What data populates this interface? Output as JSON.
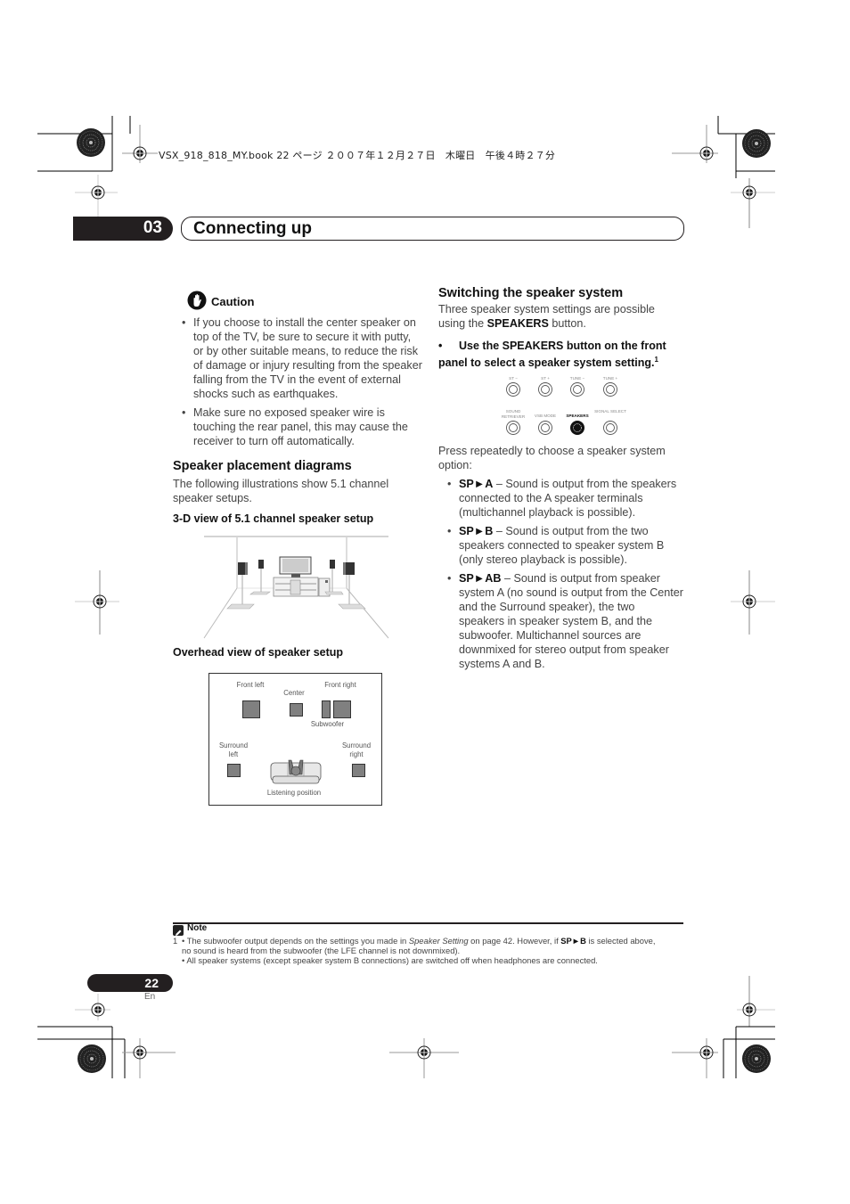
{
  "print_header": {
    "text": "VSX_918_818_MY.book  22 ページ  ２００７年１２月２７日　木曜日　午後４時２７分"
  },
  "chapter": {
    "number": "03",
    "title": "Connecting up"
  },
  "caution": {
    "title": "Caution",
    "icon": "hand-stop-icon",
    "items": [
      "If you choose to install the center speaker on top of the TV, be sure to secure it with putty, or by other suitable means, to reduce the risk of damage or injury resulting from the speaker falling from the TV in the event of external shocks such as earthquakes.",
      "Make sure no exposed speaker wire is touching the rear panel, this may cause the receiver to turn off automatically."
    ]
  },
  "placement": {
    "heading": "Speaker placement diagrams",
    "intro": "The following illustrations show 5.1 channel speaker setups.",
    "view3d_heading": "3-D view of 5.1 channel speaker setup",
    "overhead_heading": "Overhead view of speaker setup",
    "overhead_labels": {
      "front_left": "Front left",
      "center": "Center",
      "front_right": "Front right",
      "subwoofer": "Subwoofer",
      "surround_left": "Surround left",
      "surround_right": "Surround right",
      "listening_position": "Listening position"
    }
  },
  "switching": {
    "heading": "Switching the speaker system",
    "intro_pre": "Three speaker system settings are possible using the ",
    "intro_bold": "SPEAKERS",
    "intro_post": " button.",
    "step": "Use the SPEAKERS button on the front panel to select a speaker system setting.",
    "step_footnote": "1",
    "panel_buttons_row1": [
      "ST −",
      "ST +",
      "TUNE −",
      "TUNE +"
    ],
    "panel_buttons_row2": [
      "SOUND RETRIEVER",
      "VSB MODE",
      "SPEAKERS",
      "SIGNAL SELECT"
    ],
    "panel_active": "SPEAKERS",
    "press_text": "Press repeatedly to choose a speaker system option:",
    "options": [
      {
        "label": "SP►A",
        "text": " – Sound is output from the speakers connected to the A speaker terminals (multichannel playback is possible)."
      },
      {
        "label": "SP►B",
        "text": " – Sound is output from the two speakers connected to speaker system B (only stereo playback is possible)."
      },
      {
        "label": "SP►AB",
        "text": " – Sound is output from speaker system A (no sound is output from the Center and the Surround speaker), the two speakers in speaker system B, and the subwoofer. Multichannel sources are downmixed for stereo output from speaker systems A and B."
      }
    ]
  },
  "note": {
    "title": "Note",
    "footnote_number": "1",
    "line1_pre": "• The subwoofer output depends on the settings you made in ",
    "line1_italic": "Speaker Setting",
    "line1_mid": " on page 42. However, if ",
    "line1_bold": "SP►B",
    "line1_post": " is selected above,",
    "line2": "no sound is heard from the subwoofer (the LFE channel is not downmixed).",
    "line3": "• All speaker systems (except speaker system B connections) are switched off when headphones are connected."
  },
  "footer": {
    "page_number": "22",
    "language": "En"
  }
}
